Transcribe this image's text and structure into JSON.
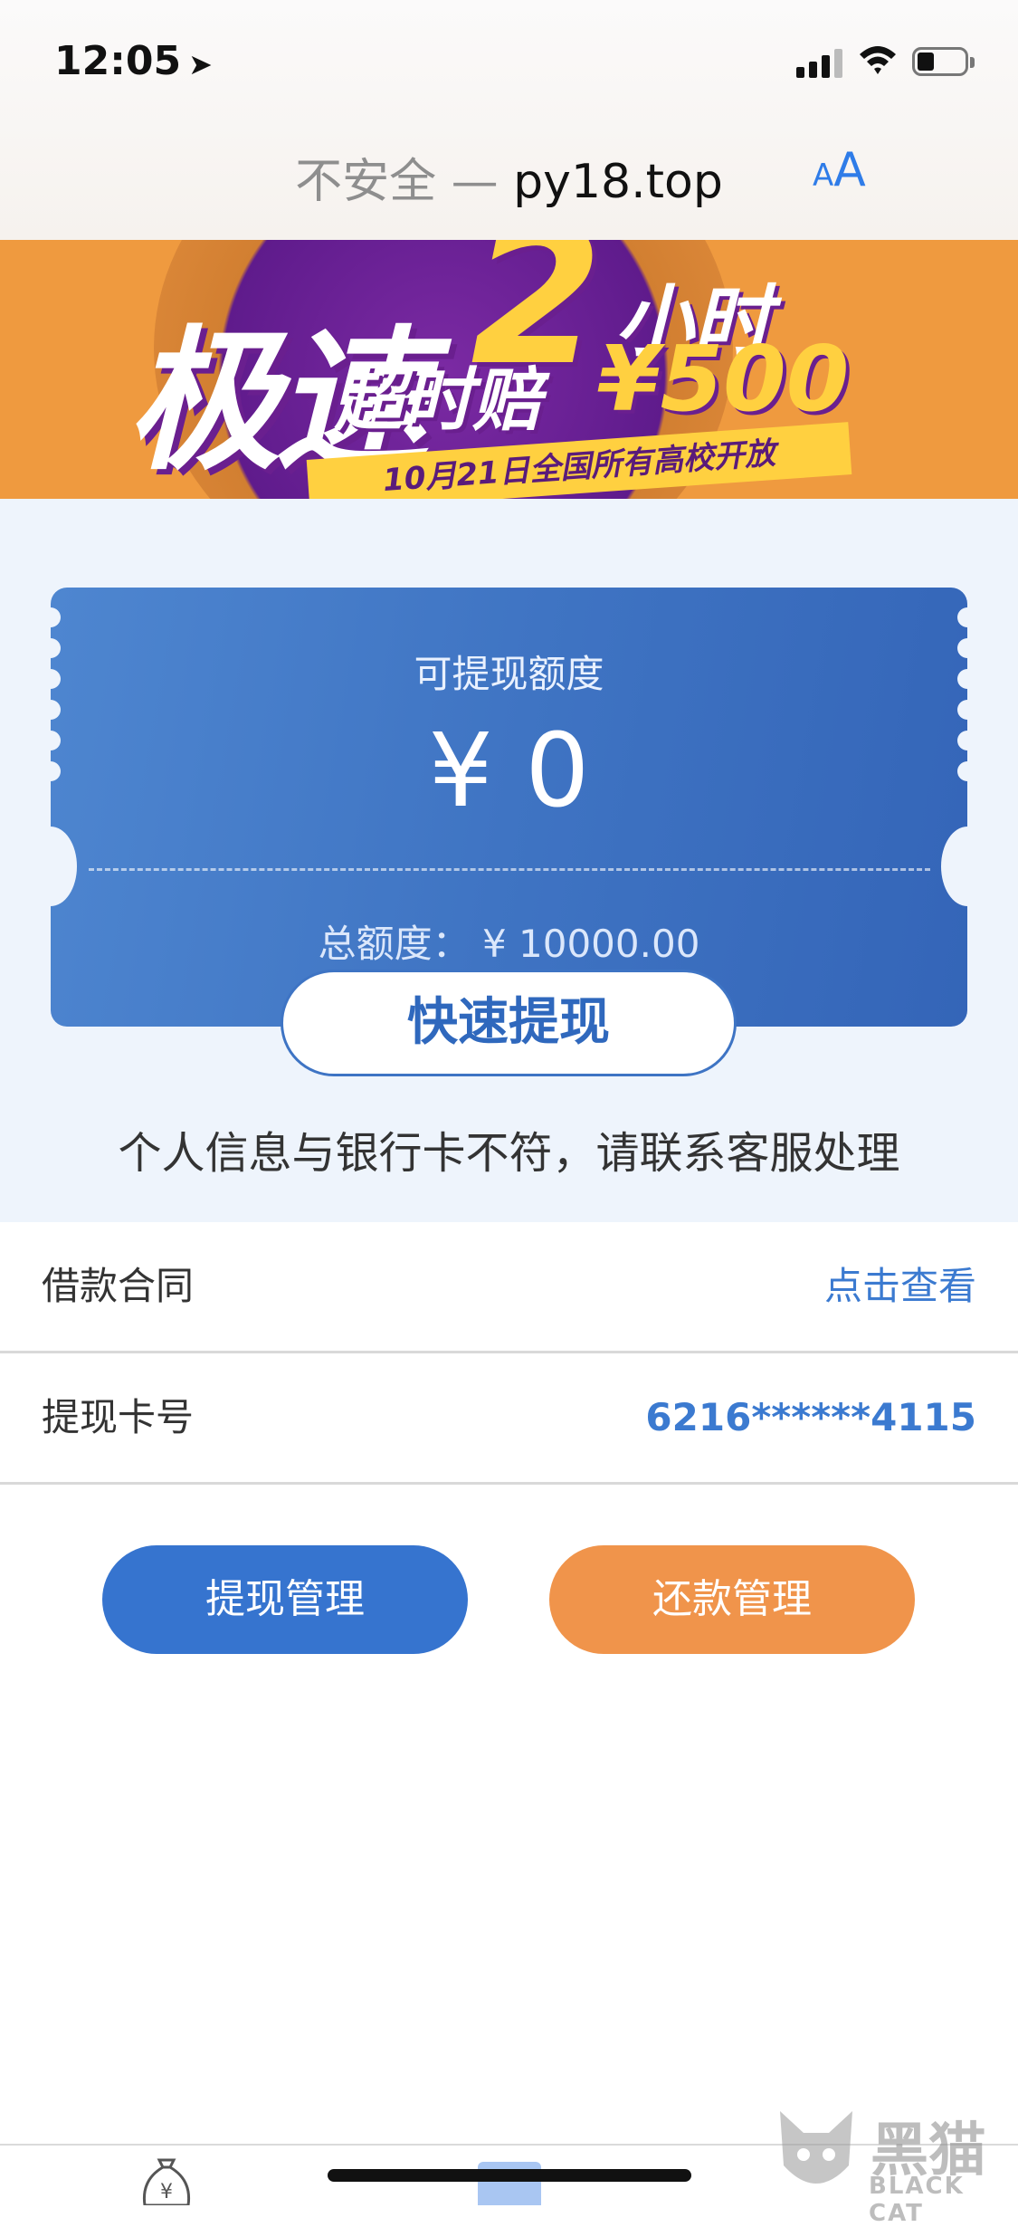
{
  "status_bar": {
    "time": "12:05"
  },
  "browser": {
    "insecure_label": "不安全 —",
    "domain": "py18.top",
    "text_size_small": "A",
    "text_size_large": "A"
  },
  "banner": {
    "headline": "极速",
    "hours_number": "2",
    "hours_text": "小时",
    "overtime_text": "超时赔",
    "compensation": "¥500",
    "ribbon": "10月21日全国所有高校开放"
  },
  "card": {
    "available_label": "可提现额度",
    "available_value": "¥ 0",
    "total_label": "总额度：",
    "total_value": "¥ 10000.00",
    "withdraw_button": "快速提现",
    "notice": "个人信息与银行卡不符，请联系客服处理"
  },
  "rows": [
    {
      "label": "借款合同",
      "value": "点击查看"
    },
    {
      "label": "提现卡号",
      "value": "6216******4115"
    }
  ],
  "actions": {
    "withdraw_manage": "提现管理",
    "repay_manage": "还款管理"
  },
  "watermark": {
    "cn": "黑猫",
    "en": "BLACK CAT"
  },
  "tabbar": {
    "money_icon_glyph": "¥"
  },
  "colors": {
    "primary": "#3674cf",
    "accent": "#f0944b",
    "card_bg": "#eef4fc",
    "link": "#3b7ad0"
  }
}
